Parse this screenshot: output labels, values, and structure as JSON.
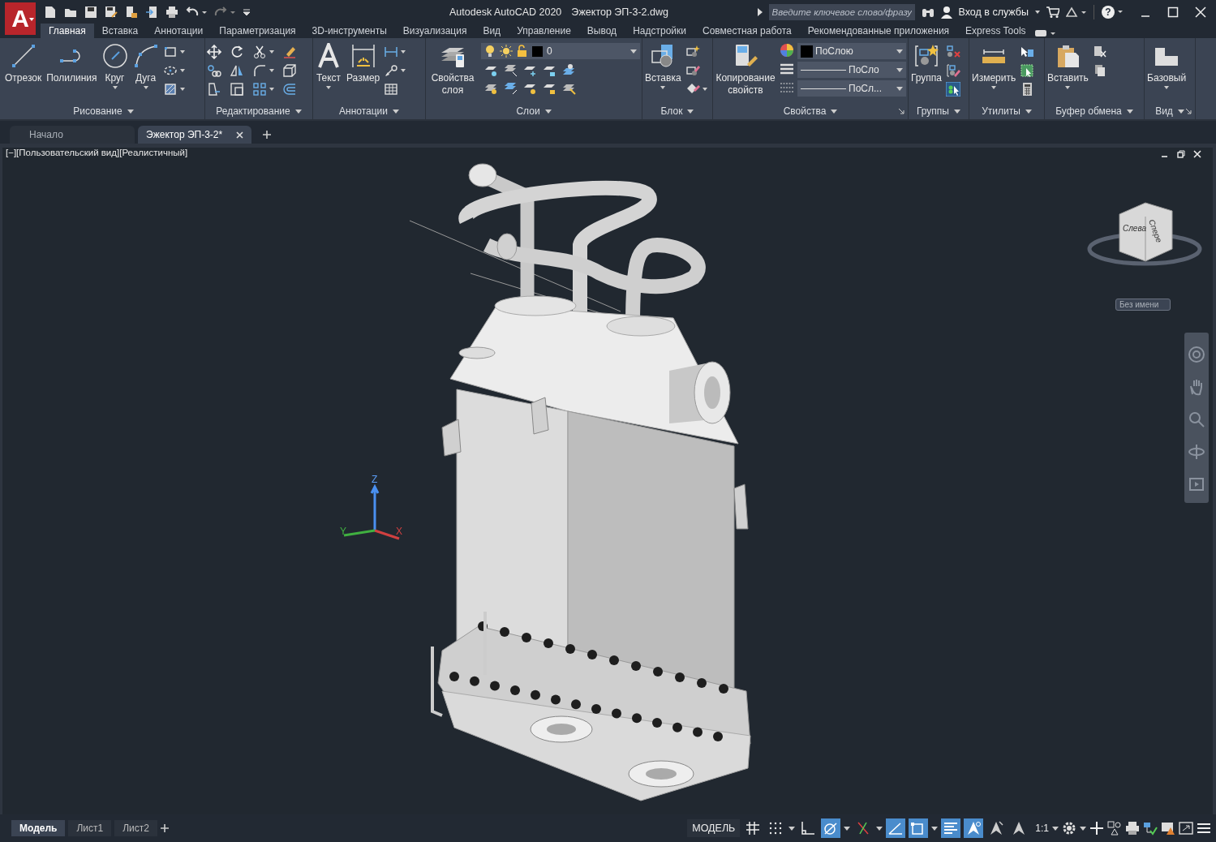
{
  "title_bar": {
    "logo": "A",
    "app_title": "Autodesk AutoCAD 2020",
    "file_name": "Эжектор ЭП-3-2.dwg",
    "search": {
      "placeholder": "Введите ключевое слово/фразу"
    },
    "sign_in": "Вход в службы",
    "help": "?"
  },
  "ribbon_tabs": [
    {
      "label": "Главная",
      "selected": true
    },
    {
      "label": "Вставка",
      "selected": false
    },
    {
      "label": "Аннотации",
      "selected": false
    },
    {
      "label": "Параметризация",
      "selected": false
    },
    {
      "label": "3D-инструменты",
      "selected": false
    },
    {
      "label": "Визуализация",
      "selected": false
    },
    {
      "label": "Вид",
      "selected": false
    },
    {
      "label": "Управление",
      "selected": false
    },
    {
      "label": "Вывод",
      "selected": false
    },
    {
      "label": "Надстройки",
      "selected": false
    },
    {
      "label": "Совместная работа",
      "selected": false
    },
    {
      "label": "Рекомендованные приложения",
      "selected": false
    },
    {
      "label": "Express Tools",
      "selected": false
    }
  ],
  "ribbon": {
    "panels": [
      {
        "kind": "draw",
        "title": "Рисование",
        "launcher": false,
        "buttons": [
          {
            "kind": "line",
            "label": "Отрезок",
            "has_menu": false
          },
          {
            "kind": "polyline",
            "label": "Полилиния",
            "has_menu": false
          },
          {
            "kind": "circle",
            "label": "Круг",
            "has_menu": true
          },
          {
            "kind": "arc",
            "label": "Дуга",
            "has_menu": true
          }
        ]
      },
      {
        "kind": "modify",
        "title": "Редактирование",
        "launcher": false
      },
      {
        "kind": "annotation",
        "title": "Аннотации",
        "launcher": false,
        "buttons": [
          {
            "kind": "text",
            "label": "Текст",
            "has_menu": true
          },
          {
            "kind": "dimension",
            "label": "Размер",
            "has_menu": false
          }
        ]
      },
      {
        "kind": "layers",
        "title": "Слои",
        "launcher": false,
        "buttons": [
          {
            "kind": "layer-properties",
            "label": "Свойства слоя",
            "has_menu": false
          }
        ],
        "layer": {
          "value": "0"
        }
      },
      {
        "kind": "block",
        "title": "Блок",
        "launcher": false,
        "buttons": [
          {
            "kind": "insert",
            "label": "Вставка",
            "has_menu": true
          }
        ]
      },
      {
        "kind": "properties",
        "title": "Свойства",
        "launcher": true,
        "buttons": [
          {
            "kind": "match",
            "label": "Копирование свойств",
            "has_menu": false
          }
        ],
        "dropdowns": [
          "ПоСлою",
          "ПоСло",
          "ПоСл..."
        ]
      },
      {
        "kind": "groups",
        "title": "Группы",
        "launcher": false,
        "buttons": [
          {
            "kind": "group",
            "label": "Группа",
            "has_menu": false
          }
        ]
      },
      {
        "kind": "utilities",
        "title": "Утилиты",
        "launcher": false,
        "buttons": [
          {
            "kind": "measure",
            "label": "Измерить",
            "has_menu": true
          }
        ]
      },
      {
        "kind": "clipboard",
        "title": "Буфер обмена",
        "launcher": false,
        "buttons": [
          {
            "kind": "paste",
            "label": "Вставить",
            "has_menu": true
          }
        ]
      },
      {
        "kind": "view",
        "title": "Вид",
        "launcher": true,
        "buttons": [
          {
            "kind": "base",
            "label": "Базовый",
            "has_menu": true
          }
        ]
      }
    ]
  },
  "document_tabs": [
    {
      "label": "Начало",
      "selected": false
    },
    {
      "label": "Эжектор ЭП-3-2*",
      "selected": true
    }
  ],
  "viewport": {
    "label": "[−][Пользовательский вид][Реалистичный]",
    "viewcube": {
      "faces": [
        "Слева",
        "Спере"
      ]
    },
    "view_name": "Без имени",
    "axes": [
      "X",
      "Y",
      "Z"
    ]
  },
  "layout_tabs": [
    {
      "label": "Модель",
      "selected": true
    },
    {
      "label": "Лист1",
      "selected": false
    },
    {
      "label": "Лист2",
      "selected": false
    }
  ],
  "status_bar": {
    "model": "МОДЕЛЬ",
    "toggles": [
      {
        "kind": "grid",
        "on": false
      },
      {
        "kind": "snap",
        "on": false
      },
      {
        "kind": "ortho",
        "on": false
      },
      {
        "kind": "polar",
        "on": true
      },
      {
        "kind": "isodraft",
        "on": false
      },
      {
        "kind": "tracking",
        "on": true
      },
      {
        "kind": "osnap",
        "on": true
      },
      {
        "kind": "lineweight",
        "on": true
      },
      {
        "kind": "annotation-visibility",
        "on": true
      },
      {
        "kind": "autoscale",
        "on": false
      },
      {
        "kind": "annotation-scale",
        "on": false
      }
    ],
    "annotation_scale": "1:1"
  }
}
